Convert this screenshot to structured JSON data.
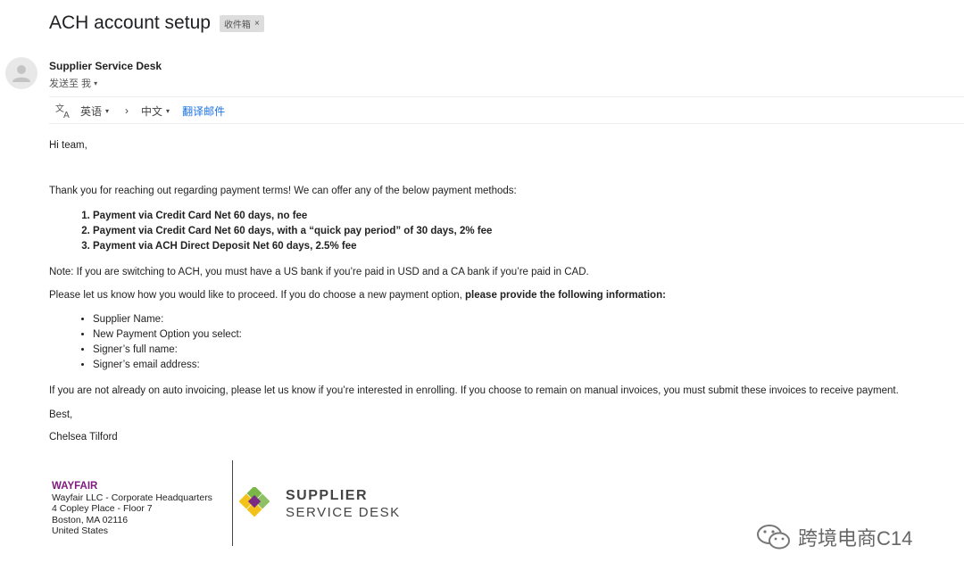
{
  "email": {
    "subject": "ACH account setup",
    "label_chip": "收件箱",
    "label_close": "×",
    "sender": "Supplier Service Desk",
    "sent_to": "发送至 我",
    "caret": "▾"
  },
  "translate_bar": {
    "source_lang": "英语",
    "arrow": "›",
    "target_lang": "中文",
    "translate_link": "翻译邮件"
  },
  "body": {
    "greeting": "Hi team,",
    "intro": "Thank you for reaching out regarding payment terms! We can offer any of the below payment methods:",
    "payment_options": [
      "Payment via Credit Card Net 60 days, no fee",
      "Payment via Credit Card Net 60 days, with a “quick pay period” of 30 days, 2% fee",
      "Payment via ACH Direct Deposit Net 60 days, 2.5% fee"
    ],
    "note": "Note: If you are switching to ACH, you must have a US bank if you’re paid in USD and a CA bank if you’re paid in CAD.",
    "proceed_plain": "Please let us know how you would like to proceed. If you do choose a new payment option, ",
    "proceed_bold": "please provide the following information:",
    "info_fields": [
      "Supplier Name:",
      "New Payment Option you select:",
      "Signer’s full name:",
      "Signer’s email address:"
    ],
    "invoicing": "If you are not already on auto invoicing, please let us know if you’re interested in enrolling. If you choose to remain on manual invoices, you must submit these invoices to receive payment.",
    "closing": "Best,",
    "signer": "Chelsea Tilford"
  },
  "signature": {
    "company": "WAYFAIR",
    "line1": "Wayfair LLC - Corporate Headquarters",
    "line2": "4 Copley Place - Floor 7",
    "line3": "Boston, MA 02116",
    "line4": "United States",
    "logo_line1": "SUPPLIER",
    "logo_line2": "SERVICE DESK"
  },
  "watermark": {
    "text": "跨境电商C14"
  },
  "colors": {
    "link_blue": "#1a73e8",
    "brand_purple": "#7f187f",
    "logo_green": "#7ab648",
    "logo_yellow": "#f2c21b",
    "logo_purple": "#7a2a83"
  }
}
